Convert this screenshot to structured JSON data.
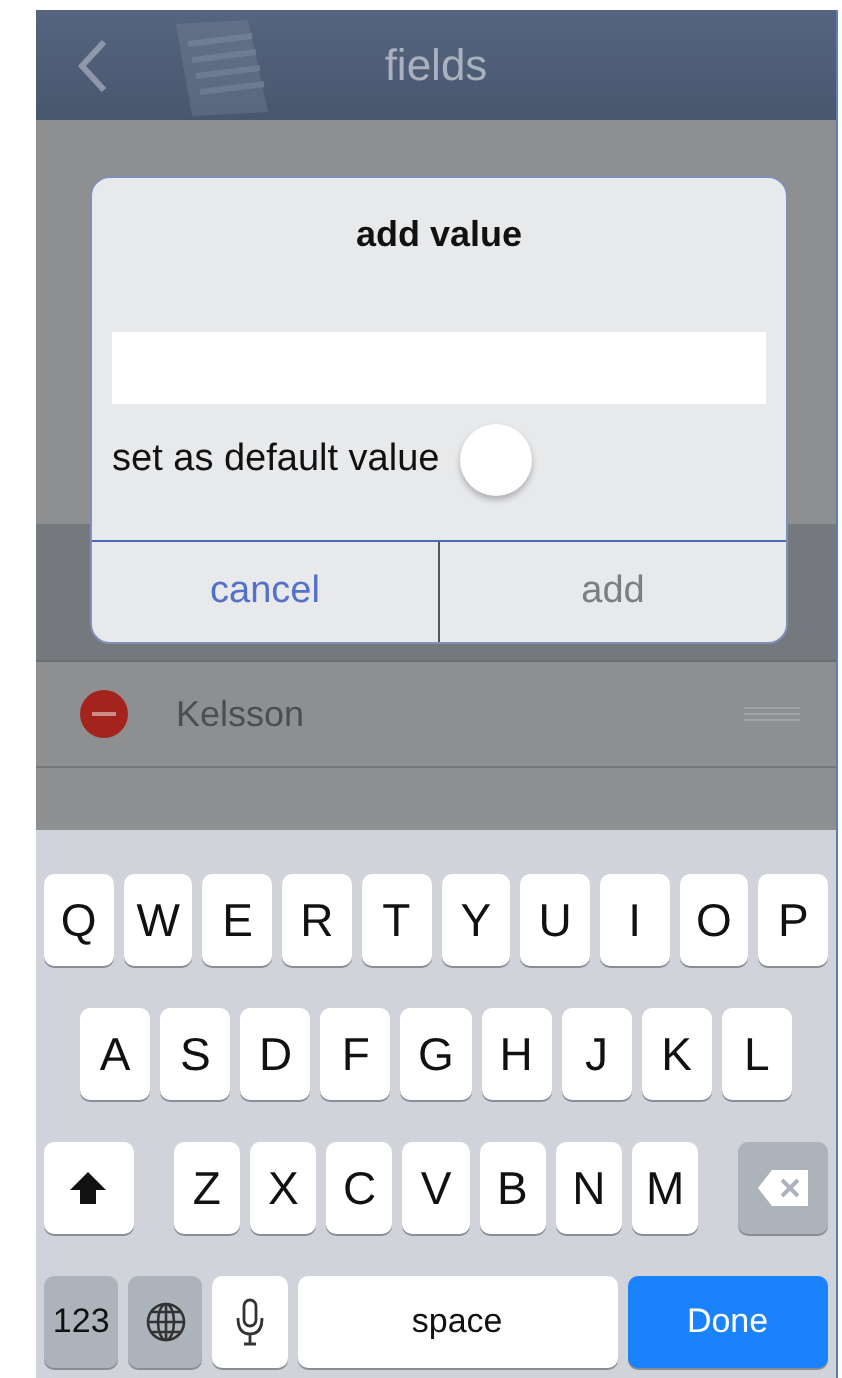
{
  "nav": {
    "title": "fields"
  },
  "list": {
    "rows": [
      {
        "name": "Kelsson"
      }
    ]
  },
  "dialog": {
    "title": "add value",
    "toggle": {
      "label": "set as default value",
      "on": false
    },
    "buttons": [
      {
        "label": "cancel",
        "kind": "cancel"
      },
      {
        "label": "add",
        "kind": "confirm"
      }
    ]
  },
  "keyboard": {
    "rows": [
      {
        "keys": [
          {
            "kind": "letter",
            "label": "Q"
          },
          {
            "kind": "letter",
            "label": "W"
          },
          {
            "kind": "letter",
            "label": "E"
          },
          {
            "kind": "letter",
            "label": "R"
          },
          {
            "kind": "letter",
            "label": "T"
          },
          {
            "kind": "letter",
            "label": "Y"
          },
          {
            "kind": "letter",
            "label": "U"
          },
          {
            "kind": "letter",
            "label": "I"
          },
          {
            "kind": "letter",
            "label": "O"
          },
          {
            "kind": "letter",
            "label": "P"
          }
        ]
      },
      {
        "keys": [
          {
            "kind": "letter",
            "label": "A"
          },
          {
            "kind": "letter",
            "label": "S"
          },
          {
            "kind": "letter",
            "label": "D"
          },
          {
            "kind": "letter",
            "label": "F"
          },
          {
            "kind": "letter",
            "label": "G"
          },
          {
            "kind": "letter",
            "label": "H"
          },
          {
            "kind": "letter",
            "label": "J"
          },
          {
            "kind": "letter",
            "label": "K"
          },
          {
            "kind": "letter",
            "label": "L"
          }
        ]
      },
      {
        "keys": [
          {
            "kind": "shift"
          },
          {
            "kind": "letter",
            "label": "Z"
          },
          {
            "kind": "letter",
            "label": "X"
          },
          {
            "kind": "letter",
            "label": "C"
          },
          {
            "kind": "letter",
            "label": "V"
          },
          {
            "kind": "letter",
            "label": "B"
          },
          {
            "kind": "letter",
            "label": "N"
          },
          {
            "kind": "letter",
            "label": "M"
          },
          {
            "kind": "delete"
          }
        ]
      },
      {
        "keys": [
          {
            "kind": "mode",
            "label": "123"
          },
          {
            "kind": "globe"
          },
          {
            "kind": "mic"
          },
          {
            "kind": "space",
            "label": "space"
          },
          {
            "kind": "done",
            "label": "Done"
          }
        ]
      }
    ]
  }
}
